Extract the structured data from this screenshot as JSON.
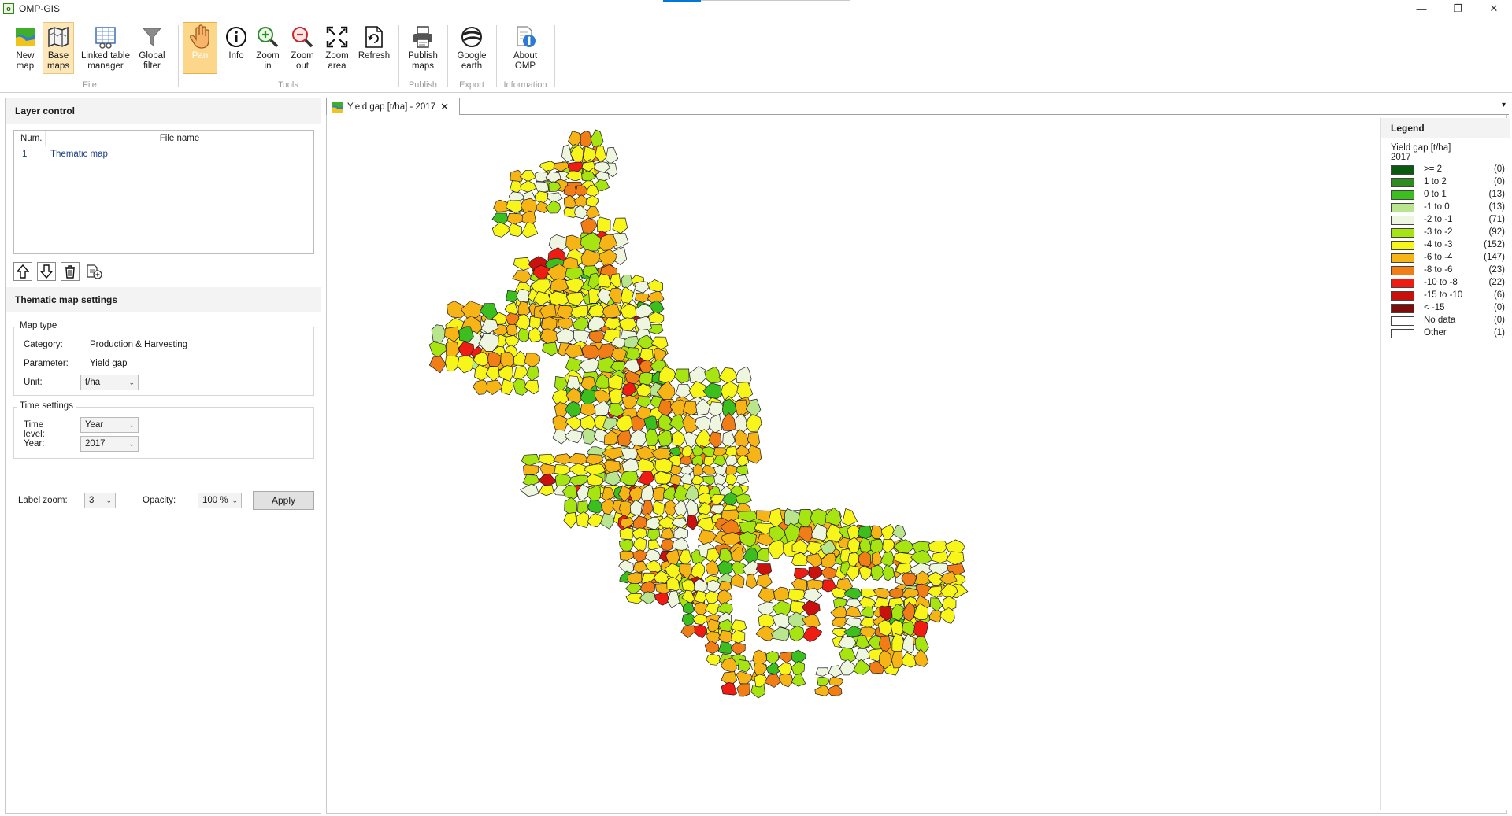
{
  "window": {
    "title": "OMP-GIS",
    "minimize": "—",
    "restore": "❐",
    "close": "✕"
  },
  "ribbon": {
    "groups": [
      {
        "label": "File",
        "buttons": [
          {
            "id": "new",
            "label": "New\nmap",
            "icon": "map-icon"
          },
          {
            "id": "base",
            "label": "Base\nmaps",
            "icon": "folded-map-icon"
          },
          {
            "id": "linked",
            "label": "Linked table\nmanager",
            "icon": "table-icon"
          },
          {
            "id": "filter",
            "label": "Global\nfilter",
            "icon": "funnel-icon"
          }
        ]
      },
      {
        "label": "Tools",
        "buttons": [
          {
            "id": "pan",
            "label": "Pan",
            "icon": "hand-icon"
          },
          {
            "id": "info",
            "label": "Info",
            "icon": "info-icon"
          },
          {
            "id": "zoomin",
            "label": "Zoom\nin",
            "icon": "zoom-in-icon"
          },
          {
            "id": "zoomout",
            "label": "Zoom\nout",
            "icon": "zoom-out-icon"
          },
          {
            "id": "zoomarea",
            "label": "Zoom\narea",
            "icon": "zoom-area-icon"
          },
          {
            "id": "refresh",
            "label": "Refresh",
            "icon": "refresh-icon"
          }
        ]
      },
      {
        "label": "Publish",
        "buttons": [
          {
            "id": "publish",
            "label": "Publish\nmaps",
            "icon": "printer-icon"
          }
        ]
      },
      {
        "label": "Export",
        "buttons": [
          {
            "id": "gearth",
            "label": "Google\nearth",
            "icon": "globe-icon"
          }
        ]
      },
      {
        "label": "Information",
        "buttons": [
          {
            "id": "about",
            "label": "About\nOMP",
            "icon": "about-icon"
          }
        ]
      }
    ]
  },
  "layer_control": {
    "title": "Layer control",
    "columns": [
      "Num.",
      "File name"
    ],
    "rows": [
      {
        "num": "1",
        "name": "Thematic map"
      }
    ]
  },
  "thematic": {
    "title": "Thematic map settings",
    "map_type": {
      "legend": "Map type",
      "category_label": "Category:",
      "category": "Production & Harvesting",
      "parameter_label": "Parameter:",
      "parameter": "Yield gap",
      "unit_label": "Unit:",
      "unit": "t/ha"
    },
    "time": {
      "legend": "Time settings",
      "level_label": "Time level:",
      "level": "Year",
      "year_label": "Year:",
      "year": "2017"
    },
    "label_zoom_label": "Label zoom:",
    "label_zoom": "3",
    "opacity_label": "Opacity:",
    "opacity": "100 %",
    "apply": "Apply"
  },
  "map": {
    "tab": "Yield gap [t/ha] - 2017",
    "tab_close": "✕",
    "tab_menu": "▾"
  },
  "legend": {
    "title": "Legend",
    "param": "Yield gap [t/ha]",
    "year": "2017",
    "classes": [
      {
        "label": ">= 2",
        "count": "(0)",
        "color": "#0b5a12"
      },
      {
        "label": "1 to 2",
        "count": "(0)",
        "color": "#2e8b1e"
      },
      {
        "label": "0 to 1",
        "count": "(13)",
        "color": "#3cbf1e"
      },
      {
        "label": "-1 to 0",
        "count": "(13)",
        "color": "#b9e58f"
      },
      {
        "label": "-2 to -1",
        "count": "(71)",
        "color": "#eef6df"
      },
      {
        "label": "-3 to -2",
        "count": "(92)",
        "color": "#a7e512"
      },
      {
        "label": "-4 to -3",
        "count": "(152)",
        "color": "#f7f51a"
      },
      {
        "label": "-6 to -4",
        "count": "(147)",
        "color": "#f6b416"
      },
      {
        "label": "-8 to -6",
        "count": "(23)",
        "color": "#f07d16"
      },
      {
        "label": "-10 to -8",
        "count": "(22)",
        "color": "#ee1c13"
      },
      {
        "label": "-15 to -10",
        "count": "(6)",
        "color": "#c9110e"
      },
      {
        "label": "< -15",
        "count": "(0)",
        "color": "#7c0d0a"
      },
      {
        "label": "No data",
        "count": "(0)",
        "color": "#ffffff"
      },
      {
        "label": "Other",
        "count": "(1)",
        "color": "#ffffff"
      }
    ]
  }
}
